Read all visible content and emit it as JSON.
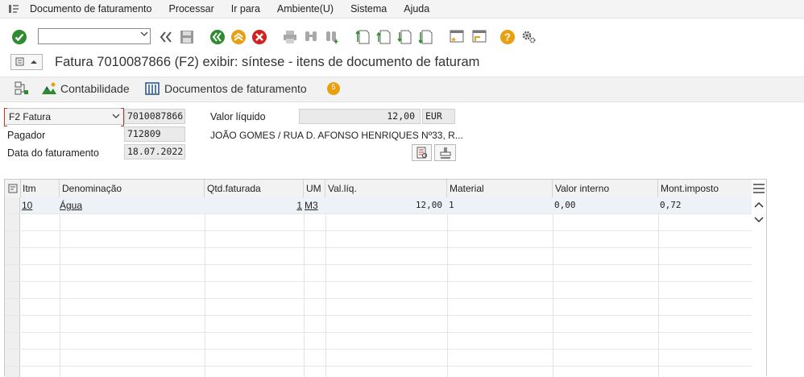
{
  "menubar": {
    "items": [
      "Documento de faturamento",
      "Processar",
      "Ir para",
      "Ambiente(U)",
      "Sistema",
      "Ajuda"
    ]
  },
  "toolbar": {
    "command_value": ""
  },
  "page": {
    "title": "Fatura 7010087866 (F2) exibir: síntese - itens de documento de faturam"
  },
  "appbar": {
    "contabilidade": "Contabilidade",
    "documentos": "Documentos de faturamento",
    "badge": "5"
  },
  "header": {
    "tipo_select": "F2 Fatura",
    "numero": "7010087866",
    "valor_liquido_label": "Valor líquido",
    "valor_liquido": "12,00",
    "moeda": "EUR",
    "pagador_label": "Pagador",
    "pagador": "712809",
    "pagador_nome": "JOÃO GOMES / RUA D. AFONSO HENRIQUES Nº33, R...",
    "data_label": "Data do faturamento",
    "data": "18.07.2022"
  },
  "table": {
    "columns": [
      "Itm",
      "Denominação",
      "Qtd.faturada",
      "UM",
      "Val.líq.",
      "Material",
      "Valor interno",
      "Mont.imposto"
    ],
    "rows": [
      {
        "itm": "10",
        "denominacao": "Água",
        "qtd": "1",
        "um": "M3",
        "val": "12,00",
        "material": "1",
        "interno": "0,00",
        "imposto": "0,72"
      }
    ]
  },
  "colors": {
    "accent_green": "#2e8b2e",
    "accent_orange": "#e8a010",
    "accent_red": "#d02020",
    "sap_blue": "#1f4e8c"
  }
}
